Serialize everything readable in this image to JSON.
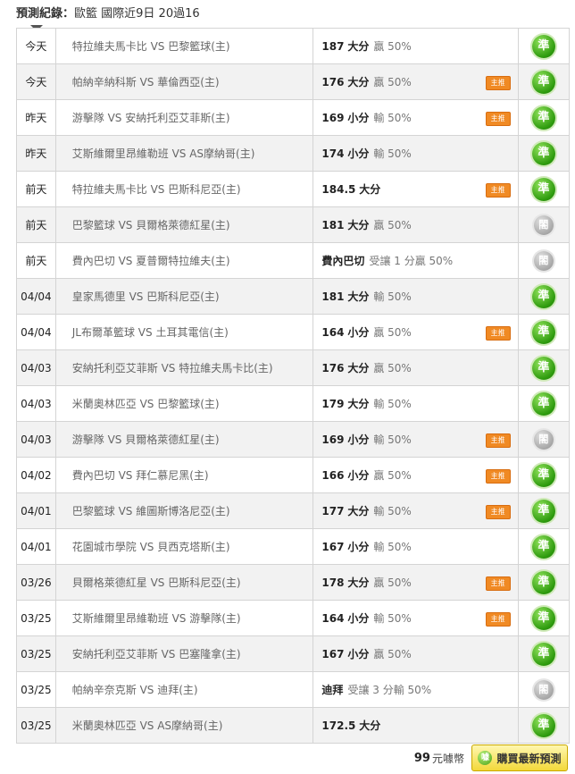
{
  "header": {
    "label": "預測紀錄：",
    "summary": "歐籃 國際近9日 20過16"
  },
  "rows": [
    {
      "date": "今天",
      "match": "特拉維夫馬卡比 VS 巴黎籃球(主)",
      "line": "187",
      "pick": "大分",
      "result_text": "贏 50%",
      "badge": "",
      "outcome": "準"
    },
    {
      "date": "今天",
      "match": "帕納辛納科斯 VS 華倫西亞(主)",
      "line": "176",
      "pick": "大分",
      "result_text": "贏 50%",
      "badge": "主推",
      "outcome": "準"
    },
    {
      "date": "昨天",
      "match": "游擊隊 VS 安納托利亞艾菲斯(主)",
      "line": "169",
      "pick": "小分",
      "result_text": "輸 50%",
      "badge": "主推",
      "outcome": "準"
    },
    {
      "date": "昨天",
      "match": "艾斯維爾里昂維勒班 VS AS摩納哥(主)",
      "line": "174",
      "pick": "小分",
      "result_text": "輸 50%",
      "badge": "",
      "outcome": "準"
    },
    {
      "date": "前天",
      "match": "特拉維夫馬卡比 VS 巴斯科尼亞(主)",
      "line": "184.5",
      "pick": "大分",
      "result_text": "",
      "badge": "主推",
      "outcome": "準"
    },
    {
      "date": "前天",
      "match": "巴黎籃球 VS 貝爾格萊德紅星(主)",
      "line": "181",
      "pick": "大分",
      "result_text": "贏 50%",
      "badge": "",
      "outcome": "閤"
    },
    {
      "date": "前天",
      "match": "費內巴切 VS 夏普爾特拉維夫(主)",
      "line": "",
      "pick": "費內巴切",
      "result_text": "受讓 1 分贏 50%",
      "badge": "",
      "outcome": "閤"
    },
    {
      "date": "04/04",
      "match": "皇家馬德里 VS 巴斯科尼亞(主)",
      "line": "181",
      "pick": "大分",
      "result_text": "輸 50%",
      "badge": "",
      "outcome": "準"
    },
    {
      "date": "04/04",
      "match": "JL布爾革籃球 VS 土耳其電信(主)",
      "line": "164",
      "pick": "小分",
      "result_text": "贏 50%",
      "badge": "主推",
      "outcome": "準"
    },
    {
      "date": "04/03",
      "match": "安納托利亞艾菲斯 VS 特拉維夫馬卡比(主)",
      "line": "176",
      "pick": "大分",
      "result_text": "贏 50%",
      "badge": "",
      "outcome": "準"
    },
    {
      "date": "04/03",
      "match": "米蘭奧林匹亞 VS 巴黎籃球(主)",
      "line": "179",
      "pick": "大分",
      "result_text": "輸 50%",
      "badge": "",
      "outcome": "準"
    },
    {
      "date": "04/03",
      "match": "游擊隊 VS 貝爾格萊德紅星(主)",
      "line": "169",
      "pick": "小分",
      "result_text": "輸 50%",
      "badge": "主推",
      "outcome": "閤"
    },
    {
      "date": "04/02",
      "match": "費內巴切 VS 拜仁慕尼黑(主)",
      "line": "166",
      "pick": "小分",
      "result_text": "贏 50%",
      "badge": "主推",
      "outcome": "準"
    },
    {
      "date": "04/01",
      "match": "巴黎籃球 VS 維圖斯博洛尼亞(主)",
      "line": "177",
      "pick": "大分",
      "result_text": "輸 50%",
      "badge": "主推",
      "outcome": "準"
    },
    {
      "date": "04/01",
      "match": "花園城市學院 VS 貝西克塔斯(主)",
      "line": "167",
      "pick": "小分",
      "result_text": "輸 50%",
      "badge": "",
      "outcome": "準"
    },
    {
      "date": "03/26",
      "match": "貝爾格萊德紅星 VS 巴斯科尼亞(主)",
      "line": "178",
      "pick": "大分",
      "result_text": "贏 50%",
      "badge": "主推",
      "outcome": "準"
    },
    {
      "date": "03/25",
      "match": "艾斯維爾里昂維勒班 VS 游擊隊(主)",
      "line": "164",
      "pick": "小分",
      "result_text": "輸 50%",
      "badge": "主推",
      "outcome": "準"
    },
    {
      "date": "03/25",
      "match": "安納托利亞艾菲斯 VS 巴塞隆拿(主)",
      "line": "167",
      "pick": "小分",
      "result_text": "贏 50%",
      "badge": "",
      "outcome": "準"
    },
    {
      "date": "03/25",
      "match": "帕納辛奈克斯 VS 迪拜(主)",
      "line": "",
      "pick": "迪拜",
      "result_text": "受讓 3 分輸 50%",
      "badge": "",
      "outcome": "閤"
    },
    {
      "date": "03/25",
      "match": "米蘭奧林匹亞 VS AS摩納哥(主)",
      "line": "172.5",
      "pick": "大分",
      "result_text": "",
      "badge": "",
      "outcome": "準"
    }
  ],
  "footer": {
    "price": "99",
    "currency": "元噱幣",
    "buy_label": "購買最新預測",
    "coin_icon_text": "噱"
  }
}
